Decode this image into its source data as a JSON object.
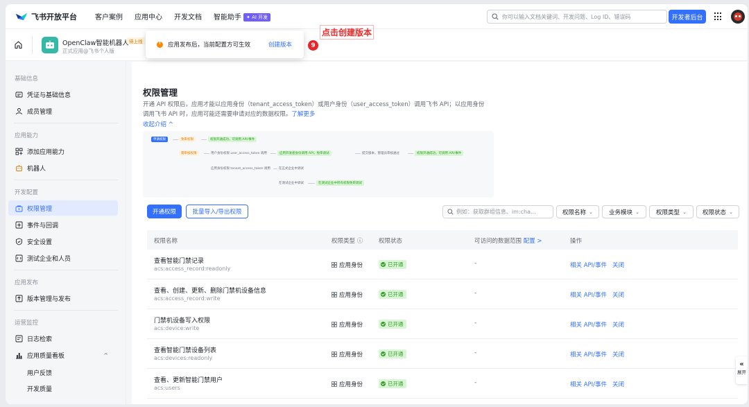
{
  "topnav": {
    "logo_text": "飞书开放平台",
    "items": [
      "客户案例",
      "应用中心",
      "开发文档",
      "智能助手"
    ],
    "ai_badge": "AI 开发",
    "search_placeholder": "你可以输入文档关键词、开发问题、Log ID、错误码",
    "dev_button": "开发者后台"
  },
  "app": {
    "name": "OpenClaw智能机器人",
    "status": "待上线",
    "sub": "正式应用@飞书个人版"
  },
  "tooltip": {
    "text": "应用发布后，当前配置方可生效",
    "link": "创建版本",
    "step": "9",
    "callout": "点击创建版本"
  },
  "sidebar": {
    "sections": [
      "基础信息",
      "应用能力",
      "开发配置",
      "应用发布",
      "运营监控"
    ],
    "items": [
      "凭证与基础信息",
      "成员管理",
      "添加应用能力",
      "机器人",
      "权限管理",
      "事件与回调",
      "安全设置",
      "测试企业和人员",
      "版本管理与发布",
      "日志检索",
      "应用质量看板"
    ],
    "sub_items": [
      "用户反馈",
      "开发质量"
    ]
  },
  "main": {
    "title": "权限管理",
    "desc_line1": "开通 API 权限后，应用才能以应用身份（tenant_access_token）或用户身份（user_access_token）调用飞书 API；以应用身份",
    "desc_line2": "调用飞书 API 时，应用可能还需要申请对应的数据权限。",
    "desc_link": "了解更多",
    "collapse": "收起介绍 ^",
    "flow": {
      "start": "申请权限",
      "free": "免审权限",
      "free_done": "权限开通成功，可调用 API/事件",
      "review": "需审核权限",
      "user_perm": "用户身份权限 user_access_token 调用",
      "user_test": "应用开发者身份调用 API，免审调试",
      "submit": "提交版本，管理员审核通过",
      "done": "权限开通成功，可调用 API/事件",
      "app_perm": "应用身份权限 tenant_access_token 调用",
      "formal": "在正式企业中调试",
      "test_corp": "在测试企业中调试",
      "test_done": "在测试企业中所有权限免审调试"
    },
    "btn_open": "开通权限",
    "btn_batch": "批量导入/导出权限",
    "filter_placeholder": "例如：获取群组信息、im:cha...",
    "filters": [
      "权限名称",
      "业务模块",
      "权限类型",
      "权限状态"
    ]
  },
  "table": {
    "headers": {
      "name": "权限名称",
      "type": "权限类型 ⓘ",
      "status": "权限状态",
      "scope": "可访问的数据范围",
      "scope_link": "配置 >",
      "ops": "操作"
    },
    "rows": [
      {
        "name": "查看智能门禁记录",
        "code": "acs:access_record:readonly",
        "type": "应用身份",
        "status": "已开通",
        "scope": "-",
        "api": "相关 API/事件",
        "close": "关闭"
      },
      {
        "name": "查看、创建、更新、删除门禁机设备信息",
        "code": "acs:access_record:write",
        "type": "应用身份",
        "status": "已开通",
        "scope": "-",
        "api": "相关 API/事件",
        "close": "关闭"
      },
      {
        "name": "门禁机设备写入权限",
        "code": "acs:device:write",
        "type": "应用身份",
        "status": "已开通",
        "scope": "-",
        "api": "相关 API/事件",
        "close": "关闭"
      },
      {
        "name": "查看智能门禁设备列表",
        "code": "acs:devices:readonly",
        "type": "应用身份",
        "status": "已开通",
        "scope": "-",
        "api": "相关 API/事件",
        "close": "关闭"
      },
      {
        "name": "查看、更新智能门禁用户",
        "code": "acs:users",
        "type": "应用身份",
        "status": "已开通",
        "scope": "-",
        "api": "相关 API/事件",
        "close": "关闭"
      }
    ]
  },
  "side_expand": "展开",
  "colors": {
    "primary": "#3370ff",
    "success": "#2ea121",
    "warning": "#ff8800",
    "annotation": "#ee2a2a"
  }
}
